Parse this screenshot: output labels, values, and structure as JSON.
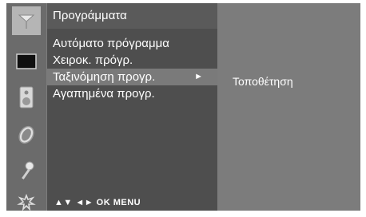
{
  "menu": {
    "title": "Προγράμματα",
    "items": [
      {
        "label": "Αυτόματο πρόγραμμα"
      },
      {
        "label": "Χειροκ. πρόγρ."
      },
      {
        "label": "Ταξινόμηση προγρ.",
        "arrow": "►"
      },
      {
        "label": "Αγαπημένα προγρ."
      }
    ],
    "active_index": 2
  },
  "hint_bar": {
    "text": "▲▼ ◄► OK MENU"
  },
  "submenu": {
    "items": [
      {
        "label": "Τοποθέτηση"
      }
    ]
  },
  "sidebar": {
    "icons": [
      "antenna-icon",
      "screen-icon",
      "speaker-icon",
      "clock-icon",
      "key-icon",
      "settings-icon"
    ],
    "selected_index": 0
  },
  "colors": {
    "osd_background": "#7c7c7c",
    "menu_background": "#4e4e4e",
    "highlight": "#7a7a7a"
  }
}
